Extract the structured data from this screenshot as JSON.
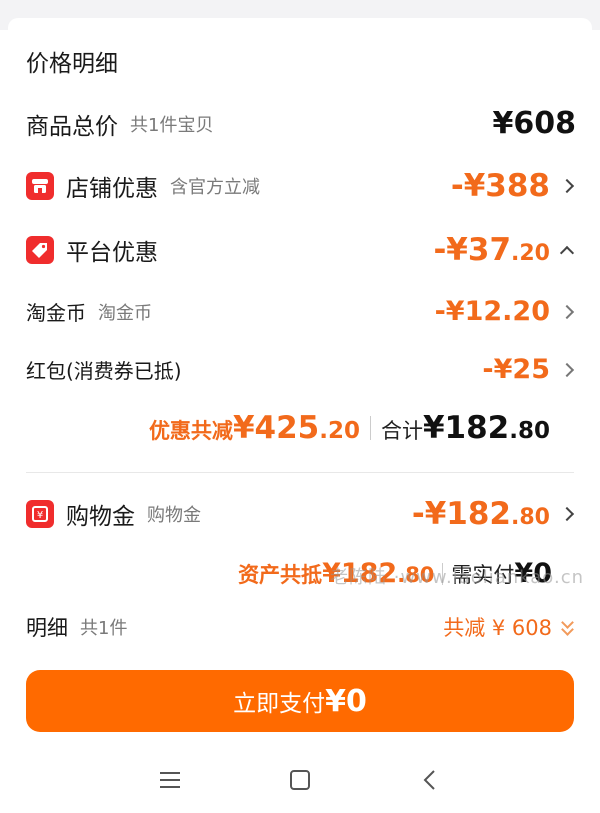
{
  "section_title": "价格明细",
  "goods_total": {
    "label": "商品总价",
    "sub": "共1件宝贝",
    "amount": "¥608"
  },
  "shop_discount": {
    "label": "店铺优惠",
    "sub": "含官方立减",
    "amount": "-¥388"
  },
  "platform_discount": {
    "label": "平台优惠",
    "amount_int": "-¥37",
    "amount_dec": ".20"
  },
  "taojin_coin": {
    "label": "淘金币",
    "sub": "淘金币",
    "amount": "-¥12.20"
  },
  "red_packet": {
    "label": "红包(消费券已抵)",
    "amount": "-¥25"
  },
  "summary": {
    "discount_label": "优惠共减",
    "discount_int": "¥425",
    "discount_dec": ".20",
    "total_label": "合计",
    "total_int": "¥182",
    "total_dec": ".80"
  },
  "shopping_gold": {
    "label": "购物金",
    "sub": "购物金",
    "amount_int": "-¥182",
    "amount_dec": ".80"
  },
  "asset": {
    "label": "资产共抵",
    "value_int": "¥182",
    "value_dec": ".80",
    "need_label": "需实付",
    "need_value": "¥0"
  },
  "watermark": "老陈陆 ·www.laoliankao.cn",
  "detail": {
    "label": "明细",
    "sub": "共1件",
    "right_text": "共减 ¥ 608"
  },
  "pay_button": {
    "label": "立即支付",
    "amount": "¥0"
  },
  "colors": {
    "accent": "#ff6a00",
    "discount_text": "#f26a1b",
    "icon_red": "#f02d2d"
  },
  "nav_icons": [
    "menu-icon",
    "home-square-icon",
    "back-icon"
  ]
}
